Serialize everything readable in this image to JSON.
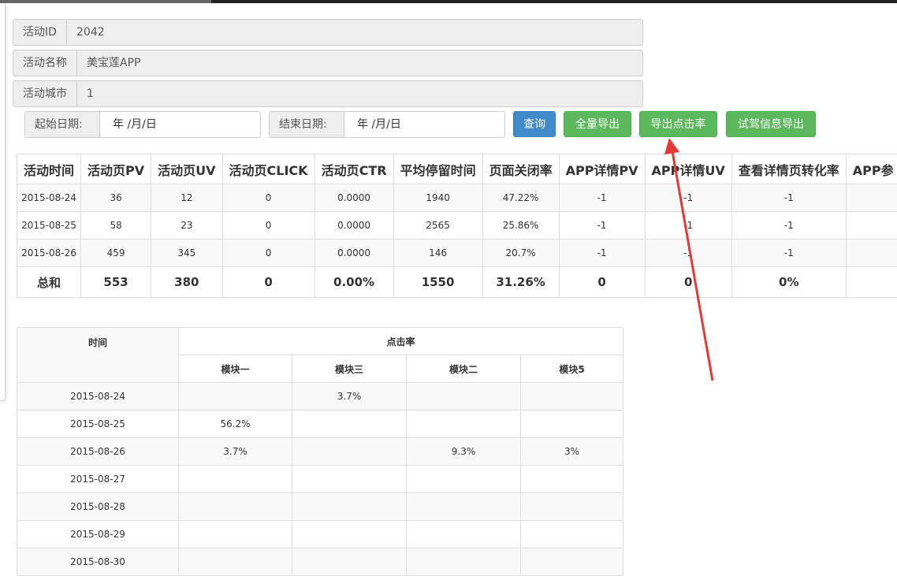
{
  "info": {
    "activity_id_label": "活动ID",
    "activity_id": "2042",
    "activity_name_label": "活动名称",
    "activity_name": "美宝莲APP",
    "activity_city_label": "活动城市",
    "activity_city": "1"
  },
  "filters": {
    "start_label": "起始日期:",
    "start_value": "年 /月/日",
    "end_label": "结束日期:",
    "end_value": "年 /月/日"
  },
  "buttons": {
    "query": "查询",
    "export_all": "全量导出",
    "export_click_rate": "导出点击率",
    "export_test_drive": "试驾信息导出"
  },
  "stats": {
    "headers": [
      "活动时间",
      "活动页PV",
      "活动页UV",
      "活动页CLICK",
      "活动页CTR",
      "平均停留时间",
      "页面关闭率",
      "APP详情PV",
      "APP详情UV",
      "查看详情页转化率",
      "APP参"
    ],
    "rows": [
      [
        "2015-08-24",
        "36",
        "12",
        "0",
        "0.0000",
        "1940",
        "47.22%",
        "-1",
        "-1",
        "-1",
        ""
      ],
      [
        "2015-08-25",
        "58",
        "23",
        "0",
        "0.0000",
        "2565",
        "25.86%",
        "-1",
        "-1",
        "-1",
        ""
      ],
      [
        "2015-08-26",
        "459",
        "345",
        "0",
        "0.0000",
        "146",
        "20.7%",
        "-1",
        "-1",
        "-1",
        ""
      ]
    ],
    "total": [
      "总和",
      "553",
      "380",
      "0",
      "0.00%",
      "1550",
      "31.26%",
      "0",
      "0",
      "0%",
      ""
    ]
  },
  "click_rate": {
    "time_header": "时间",
    "group_header": "点击率",
    "modules": [
      "模块一",
      "模块三",
      "模块二",
      "模块5"
    ],
    "rows": [
      [
        "2015-08-24",
        "",
        "3.7%",
        "",
        ""
      ],
      [
        "2015-08-25",
        "56.2%",
        "",
        "",
        ""
      ],
      [
        "2015-08-26",
        "3.7%",
        "",
        "9.3%",
        "3%"
      ],
      [
        "2015-08-27",
        "",
        "",
        "",
        ""
      ],
      [
        "2015-08-28",
        "",
        "",
        "",
        ""
      ],
      [
        "2015-08-29",
        "",
        "",
        "",
        ""
      ],
      [
        "2015-08-30",
        "",
        "",
        "",
        ""
      ]
    ]
  },
  "colors": {
    "primary": "#428bca",
    "success": "#5cb85c",
    "arrow": "#e53935"
  }
}
